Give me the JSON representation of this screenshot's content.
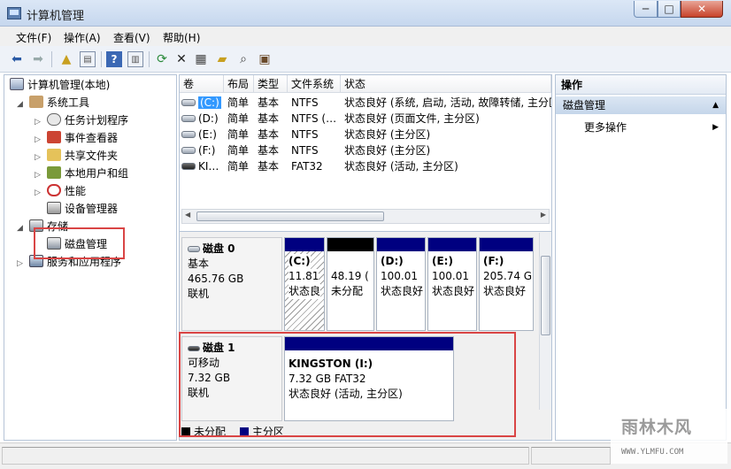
{
  "window": {
    "title": "计算机管理",
    "min": "─",
    "max": "□",
    "close": "✕"
  },
  "menu": [
    "文件(F)",
    "操作(A)",
    "查看(V)",
    "帮助(H)"
  ],
  "tree": {
    "root": "计算机管理(本地)",
    "system_tools": "系统工具",
    "items": [
      "任务计划程序",
      "事件查看器",
      "共享文件夹",
      "本地用户和组",
      "性能",
      "设备管理器"
    ],
    "storage": "存储",
    "disk_mgmt": "磁盘管理",
    "services": "服务和应用程序"
  },
  "columns": [
    "卷",
    "布局",
    "类型",
    "文件系统",
    "状态"
  ],
  "volumes": [
    {
      "name": "(C:)",
      "layout": "简单",
      "type": "基本",
      "fs": "NTFS",
      "status": "状态良好 (系统, 启动, 活动, 故障转储, 主分区",
      "selected": true
    },
    {
      "name": "(D:)",
      "layout": "简单",
      "type": "基本",
      "fs": "NTFS (…",
      "status": "状态良好 (页面文件, 主分区)"
    },
    {
      "name": "(E:)",
      "layout": "简单",
      "type": "基本",
      "fs": "NTFS",
      "status": "状态良好 (主分区)"
    },
    {
      "name": "(F:)",
      "layout": "简单",
      "type": "基本",
      "fs": "NTFS",
      "status": "状态良好 (主分区)"
    },
    {
      "name": "KI…",
      "layout": "简单",
      "type": "基本",
      "fs": "FAT32",
      "status": "状态良好 (活动, 主分区)"
    }
  ],
  "disks": [
    {
      "name": "磁盘 0",
      "kind": "基本",
      "size": "465.76 GB",
      "state": "联机",
      "partitions": [
        {
          "label": "(C:)",
          "line2": "11.81",
          "line3": "状态良"
        },
        {
          "label": "",
          "line2": "48.19 (",
          "line3": "未分配"
        },
        {
          "label": "(D:)",
          "line2": "100.01",
          "line3": "状态良好"
        },
        {
          "label": "(E:)",
          "line2": "100.01",
          "line3": "状态良好"
        },
        {
          "label": "(F:)",
          "line2": "205.74 G",
          "line3": "状态良好"
        }
      ]
    },
    {
      "name": "磁盘 1",
      "kind": "可移动",
      "size": "7.32 GB",
      "state": "联机",
      "partitions": [
        {
          "label": "KINGSTON  (I:)",
          "line2": "7.32 GB FAT32",
          "line3": "状态良好 (活动, 主分区)"
        }
      ]
    }
  ],
  "legend": {
    "unallocated": "未分配",
    "primary": "主分区"
  },
  "actions": {
    "header": "操作",
    "section": "磁盘管理",
    "more": "更多操作"
  },
  "watermark": {
    "text": "雨林木风",
    "url": "WWW.YLMFU.COM"
  },
  "colors": {
    "primary": "#000080",
    "unallocated": "#000000",
    "highlight": "#d94545"
  }
}
